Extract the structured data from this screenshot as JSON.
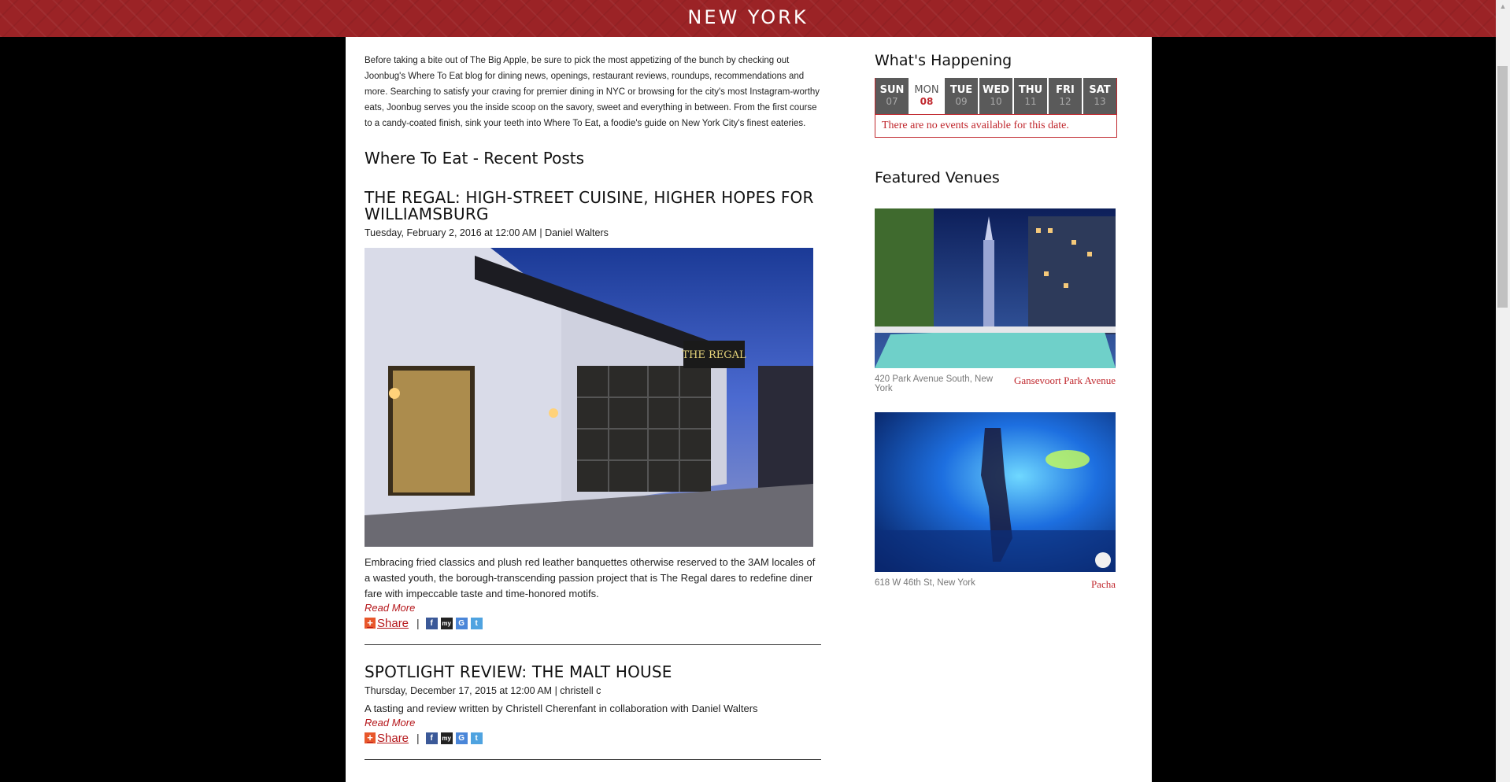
{
  "header": {
    "city": "NEW YORK"
  },
  "intro": "Before taking a bite out of The Big Apple, be sure to pick the most appetizing of the bunch by checking out Joonbug's Where To Eat blog for dining news, openings, restaurant reviews, roundups, recommendations and more. Searching to satisfy your craving for premier dining in NYC or browsing for the city's most Instagram-worthy eats, Joonbug serves you the inside scoop on the savory, sweet and everything in between. From the first course to a candy-coated finish, sink your teeth into Where To Eat, a foodie's guide on New York City's finest eateries.",
  "recent_posts_title": "Where To Eat - Recent Posts",
  "posts": [
    {
      "title": "THE REGAL: HIGH-STREET CUISINE, HIGHER HOPES FOR WILLIAMSBURG",
      "meta": "Tuesday, February 2, 2016 at 12:00 AM | Daniel Walters",
      "image_alt": "The Regal storefront",
      "excerpt": "Embracing fried classics and plush red leather banquettes otherwise reserved to the 3AM locales of a wasted youth, the borough-transcending passion project that is The Regal dares to redefine diner fare with impeccable taste and time-honored motifs.",
      "read_more": "Read More",
      "share": "Share"
    },
    {
      "title": "SPOTLIGHT REVIEW: THE MALT HOUSE",
      "meta": "Thursday, December 17, 2015 at 12:00 AM | christell c",
      "excerpt": "A tasting and review written by Christell Cherenfant in collaboration with Daniel Walters",
      "read_more": "Read More",
      "share": "Share"
    }
  ],
  "sidebar": {
    "happening_title": "What's Happening",
    "days": [
      {
        "name": "SUN",
        "date": "07"
      },
      {
        "name": "MON",
        "date": "08"
      },
      {
        "name": "TUE",
        "date": "09"
      },
      {
        "name": "WED",
        "date": "10"
      },
      {
        "name": "THU",
        "date": "11"
      },
      {
        "name": "FRI",
        "date": "12"
      },
      {
        "name": "SAT",
        "date": "13"
      }
    ],
    "no_events": "There are no events available for this date.",
    "featured_title": "Featured Venues",
    "venues": [
      {
        "address": "420 Park Avenue South, New York",
        "name": "Gansevoort Park Avenue"
      },
      {
        "address": "618 W 46th St, New York",
        "name": "Pacha"
      }
    ]
  },
  "colors": {
    "brand_red": "#9b2326",
    "link_red": "#b5171b",
    "day_bg": "#5a5a5a"
  },
  "icons": {
    "share": "plus-icon",
    "facebook": "facebook-icon",
    "myspace": "myspace-icon",
    "google": "google-icon",
    "twitter": "twitter-icon",
    "scroll_up": "chevron-up-icon"
  }
}
